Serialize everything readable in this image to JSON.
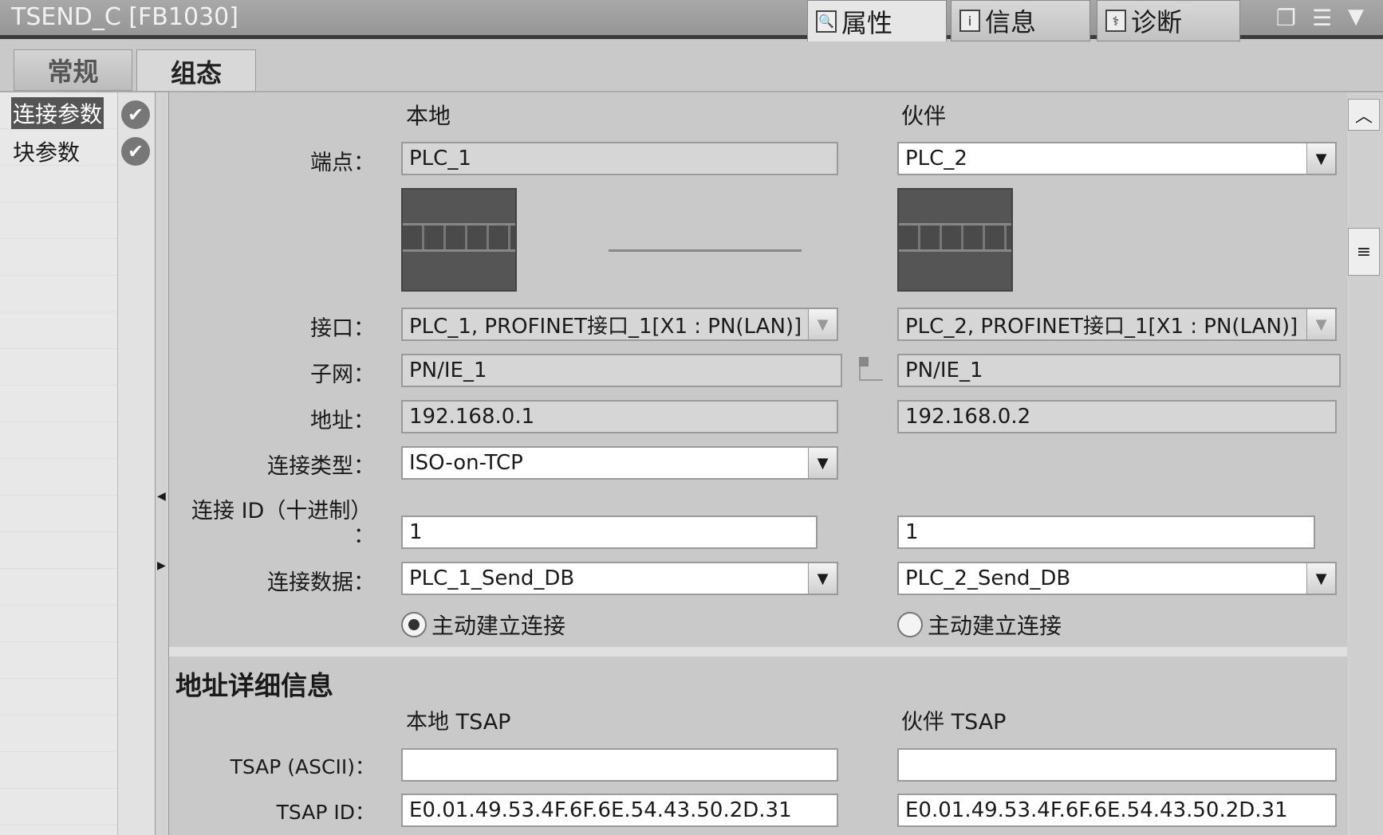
{
  "window": {
    "title": "TSEND_C [FB1030]"
  },
  "panel_tabs": [
    {
      "label": "属性",
      "icon": "properties-icon"
    },
    {
      "label": "信息",
      "icon": "info-icon"
    },
    {
      "label": "诊断",
      "icon": "diagnostics-icon"
    }
  ],
  "sub_tabs": [
    "常规",
    "组态"
  ],
  "nav": [
    {
      "label": "连接参数",
      "status": "check-icon"
    },
    {
      "label": "块参数",
      "status": "check-icon"
    }
  ],
  "columns": {
    "local": "本地",
    "partner": "伙伴"
  },
  "labels": {
    "endpoint": "端点：",
    "interface": "接口：",
    "subnet": "子网：",
    "address": "地址：",
    "conn_type": "连接类型：",
    "conn_id": "连接 ID（十进制）",
    "conn_id_colon": "：",
    "conn_data": "连接数据：",
    "tsap_ascii": "TSAP (ASCII)：",
    "tsap_id": "TSAP ID："
  },
  "local": {
    "endpoint": "PLC_1",
    "interface": "PLC_1, PROFINET接口_1[X1 : PN(LAN)]",
    "subnet": "PN/IE_1",
    "address": "192.168.0.1",
    "conn_type": "ISO-on-TCP",
    "conn_id": "1",
    "conn_data": "PLC_1_Send_DB",
    "active_label": "主动建立连接",
    "active": true,
    "tsap_ascii": "",
    "tsap_id": "E0.01.49.53.4F.6F.6E.54.43.50.2D.31"
  },
  "partner": {
    "endpoint": "PLC_2",
    "interface": "PLC_2, PROFINET接口_1[X1 : PN(LAN)]",
    "subnet": "PN/IE_1",
    "address": "192.168.0.2",
    "conn_id": "1",
    "conn_data": "PLC_2_Send_DB",
    "active_label": "主动建立连接",
    "active": false,
    "tsap_ascii": "",
    "tsap_id": "E0.01.49.53.4F.6F.6E.54.43.50.2D.31"
  },
  "address_details": {
    "title": "地址详细信息",
    "local_tsap": "本地 TSAP",
    "partner_tsap": "伙伴 TSAP"
  }
}
